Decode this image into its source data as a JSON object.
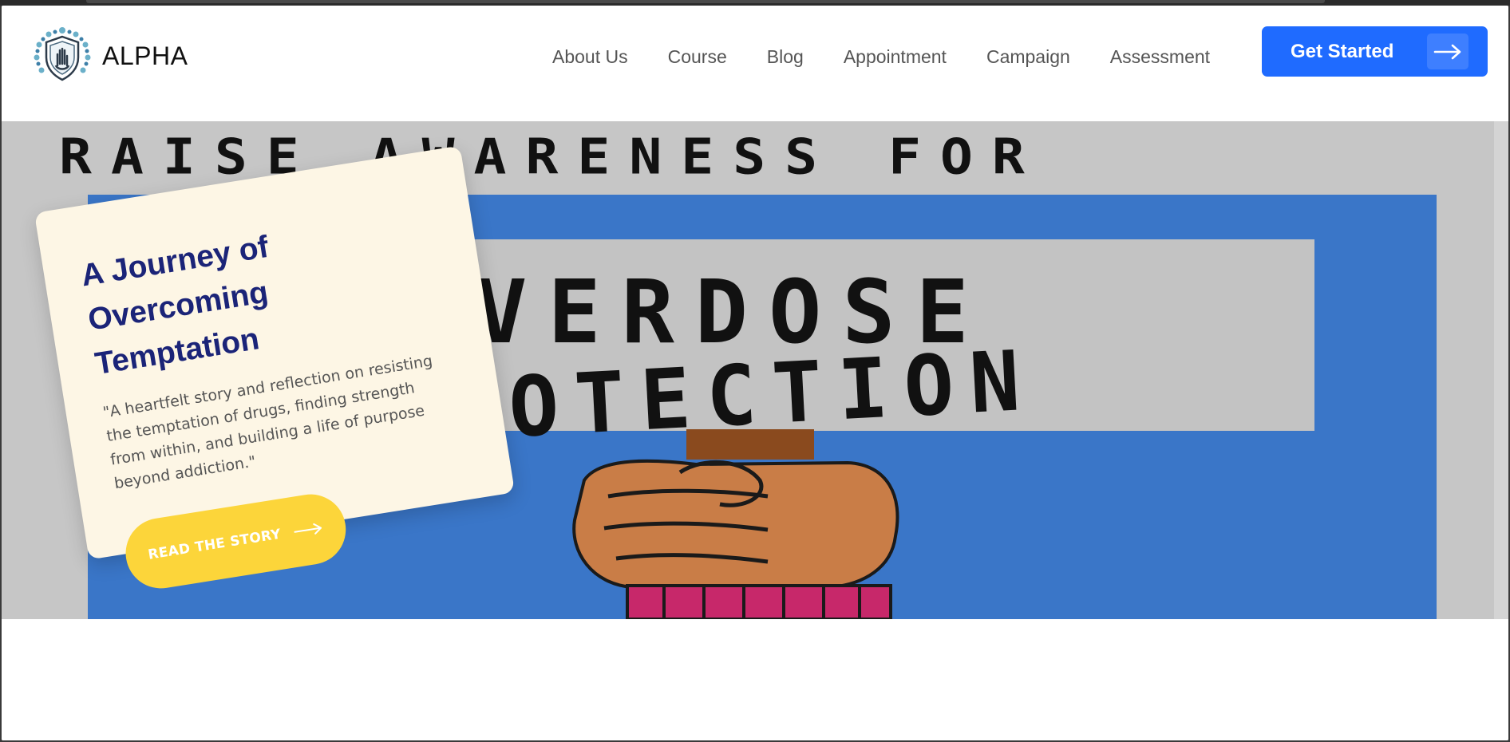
{
  "brand": {
    "name": "ALPHA"
  },
  "nav": {
    "items": [
      {
        "label": "About Us"
      },
      {
        "label": "Course"
      },
      {
        "label": "Blog"
      },
      {
        "label": "Appointment"
      },
      {
        "label": "Campaign"
      },
      {
        "label": "Assessment"
      }
    ],
    "cta_label": "Get Started"
  },
  "hero": {
    "poster_line1": "RAISE AWARENESS FOR",
    "poster_line2": "OVERDOSE",
    "poster_line3": "PROTECTION",
    "card": {
      "title": "A Journey of Overcoming Temptation",
      "description": "\"A heartfelt story and reflection on resisting the temptation of drugs, finding strength from within, and building a life of purpose beyond addiction.\"",
      "button_label": "READ THE STORY"
    }
  },
  "colors": {
    "accent": "#1f6bff",
    "card_title": "#1b2478",
    "button_yellow": "#fcd53a",
    "card_bg": "#fdf6e5",
    "poster_blue": "#3a76c8"
  }
}
